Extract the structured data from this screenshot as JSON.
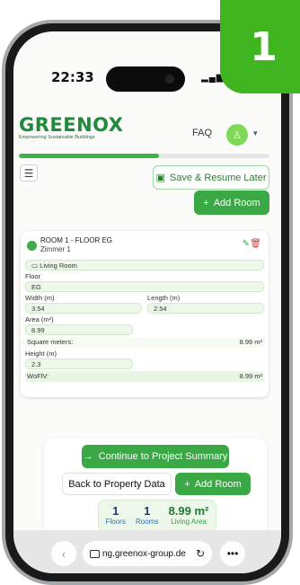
{
  "step_badge": "1",
  "status_bar": {
    "time": "22:33"
  },
  "header": {
    "logo_text": "GREENOX",
    "logo_tagline": "Empowering Sustainable Buildings",
    "faq_label": "FAQ"
  },
  "progress": {
    "fraction": 0.56
  },
  "toolbar": {
    "save_label": "Save & Resume Later",
    "add_room_label": "Add Room"
  },
  "room": {
    "title": "ROOM 1 - FLOOR EG",
    "subtitle": "Zimmer 1",
    "type": "Living Room",
    "floor_label": "Floor",
    "floor_value": "EG",
    "width_label": "Width (m)",
    "width_value": "3.54",
    "length_label": "Length (m)",
    "length_value": "2.54",
    "area_label": "Area (m²)",
    "area_value": "8.99",
    "square_meters_label": "Square meters:",
    "square_meters_value": "8.99 m²",
    "height_label": "Height (m)",
    "height_value": "2.3",
    "wofiv_label": "WoFlV:",
    "wofiv_value": "8.99 m²"
  },
  "actions": {
    "continue_label": "Continue to Project Summary",
    "back_label": "Back to Property Data",
    "add_room_label": "Add Room"
  },
  "stats": [
    {
      "value": "1",
      "label": "Floors"
    },
    {
      "value": "1",
      "label": "Rooms"
    },
    {
      "value": "8.99 m²",
      "label": "Living Area"
    }
  ],
  "browser": {
    "url": "ng.greenox-group.de"
  },
  "colors": {
    "accent": "#3aa844",
    "badge": "#3fb61f",
    "delete": "#d23636"
  }
}
